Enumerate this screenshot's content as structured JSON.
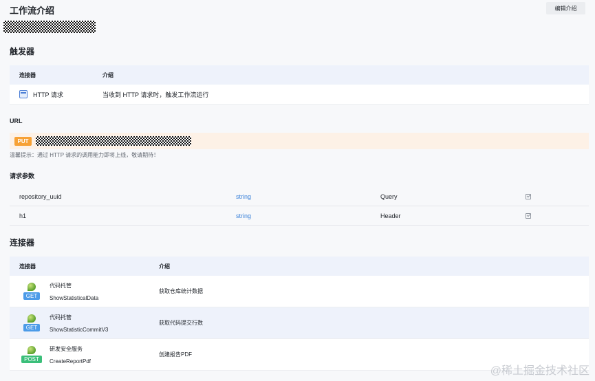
{
  "header": {
    "title": "工作流介绍",
    "edit_label": "编辑介绍"
  },
  "trigger": {
    "title": "触发器",
    "columns": [
      "连接器",
      "介绍"
    ],
    "row": {
      "name": "HTTP 请求",
      "desc": "当收到 HTTP 请求时，触发工作流运行",
      "icon": "http-request-icon"
    }
  },
  "url": {
    "title": "URL",
    "method": "PUT",
    "hint": "温馨提示：通过 HTTP 请求的调用能力即将上线，敬请期待！"
  },
  "params": {
    "title": "请求参数",
    "rows": [
      {
        "name": "repository_uuid",
        "type": "string",
        "location": "Query"
      },
      {
        "name": "h1",
        "type": "string",
        "location": "Header"
      }
    ]
  },
  "connectors": {
    "title": "连接器",
    "columns": [
      "连接器",
      "介绍"
    ],
    "rows": [
      {
        "method": "GET",
        "service": "代码托管",
        "action": "ShowStatisticalData",
        "desc": "获取仓库统计数据"
      },
      {
        "method": "GET",
        "service": "代码托管",
        "action": "ShowStatisticCommitV3",
        "desc": "获取代码提交行数"
      },
      {
        "method": "POST",
        "service": "研发安全服务",
        "action": "CreateReportPdf",
        "desc": "创建报告PDF"
      }
    ]
  },
  "watermark": "@稀土掘金技术社区",
  "colors": {
    "accent": "#3b82d9",
    "put": "#f7a135",
    "get": "#4c9be8",
    "post": "#3bbf7a"
  }
}
